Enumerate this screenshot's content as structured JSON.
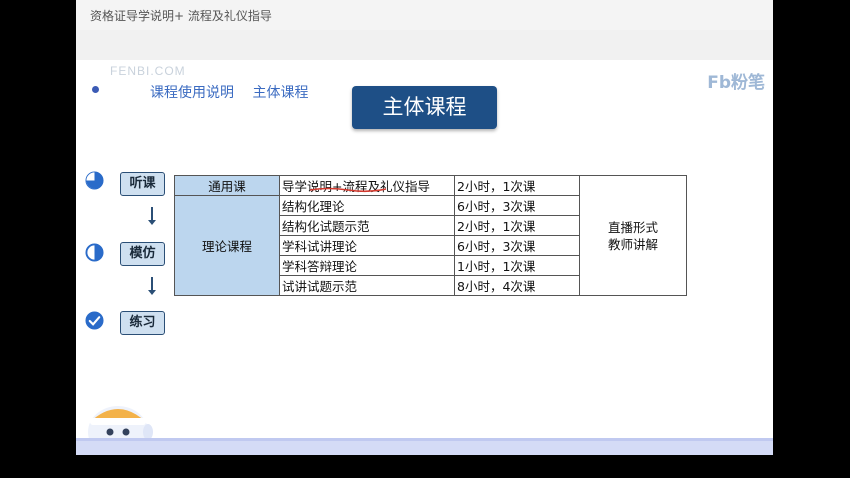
{
  "window": {
    "title": "资格证导学说明+ 流程及礼仪指导"
  },
  "watermark": "FENBI.COM",
  "logo": "Fb粉笔",
  "breadcrumb": [
    "课程使用说明",
    "主体课程"
  ],
  "main_title": "主体课程",
  "steps": [
    {
      "label": "听课",
      "icon": "half-pie-icon"
    },
    {
      "label": "模仿",
      "icon": "half-circle-icon"
    },
    {
      "label": "练习",
      "icon": "check-circle-icon"
    }
  ],
  "table": {
    "categories": [
      "通用课",
      "理论课程"
    ],
    "rows": [
      {
        "name": "导学说明+流程及礼仪指导",
        "hours": "2小时，1次课"
      },
      {
        "name": "结构化理论",
        "hours": "6小时，3次课"
      },
      {
        "name": "结构化试题示范",
        "hours": "2小时，1次课"
      },
      {
        "name": "学科试讲理论",
        "hours": "6小时，3次课"
      },
      {
        "name": "学科答辩理论",
        "hours": "1小时，1次课"
      },
      {
        "name": "试讲试题示范",
        "hours": "8小时，4次课"
      }
    ],
    "form_line1": "直播形式",
    "form_line2": "教师讲解"
  },
  "colors": {
    "accent": "#1e4f86",
    "cell_blue": "#bcd6ee",
    "link_blue": "#3b6bc1"
  }
}
